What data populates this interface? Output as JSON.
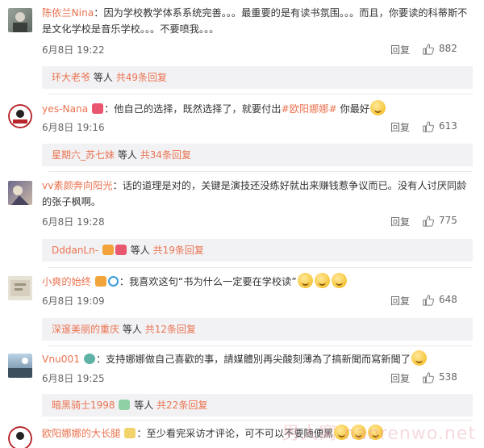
{
  "comments": [
    {
      "user": "陈依兰Nina",
      "text": "：因为学校教学体系系统完善。。。最重要的是有读书氛围。。。而且，你要读的科蒂斯不是文化学校是音乐学校。。。不要喷我。。。",
      "date": "6月8日 19:22",
      "reply_label": "回复",
      "likes": "882",
      "sub_user": "环大老爷",
      "sub_text": "等人",
      "sub_total": "共49条回复"
    },
    {
      "user": "yes-Nana",
      "text_before": "：他自己的选择，既然选择了，就要付出",
      "hashtag": "#欧阳娜娜#",
      "text_after": " 你最好",
      "date": "6月8日 19:16",
      "reply_label": "回复",
      "likes": "613",
      "sub_user": "星期六_苏七妹",
      "sub_text": "等人",
      "sub_total": "共34条回复"
    },
    {
      "user": "vv素颜奔向阳光",
      "text": "：话的道理是对的，关键是演技还没练好就出来赚钱惹争议而已。没有人讨厌同龄的张子枫啊。",
      "date": "6月8日 19:28",
      "reply_label": "回复",
      "likes": "775",
      "sub_user": "DddanLn-",
      "sub_text": "等人",
      "sub_total": "共19条回复"
    },
    {
      "user": "小爽的始终",
      "text": "：我喜欢这句“书为什么一定要在学校读”",
      "date": "6月8日 19:09",
      "reply_label": "回复",
      "likes": "648",
      "sub_user": "深邃美丽的重庆",
      "sub_text": "等人",
      "sub_total": "共12条回复"
    },
    {
      "user": "Vnu001",
      "text": "：支持娜娜做自己喜歡的事，請媒體別再尖酸刻薄為了搞新聞而寫新聞了",
      "date": "6月8日 19:25",
      "reply_label": "回复",
      "likes": "538",
      "sub_user": "暗黑骑士1998",
      "sub_text": "等人",
      "sub_total": "共22条回复"
    },
    {
      "user": "欧阳娜娜的大长腿",
      "text": "：至少看完采访才评论，可不可以不要随便黑"
    }
  ],
  "watermark": "男人窝 nanrenwo.net",
  "colors": {
    "username": "#eb7350",
    "sub_bg": "#f2f2f5",
    "text": "#333333"
  },
  "icons": {
    "like": "thumbs-up-icon",
    "emoji": "smile-emoji-icon"
  }
}
